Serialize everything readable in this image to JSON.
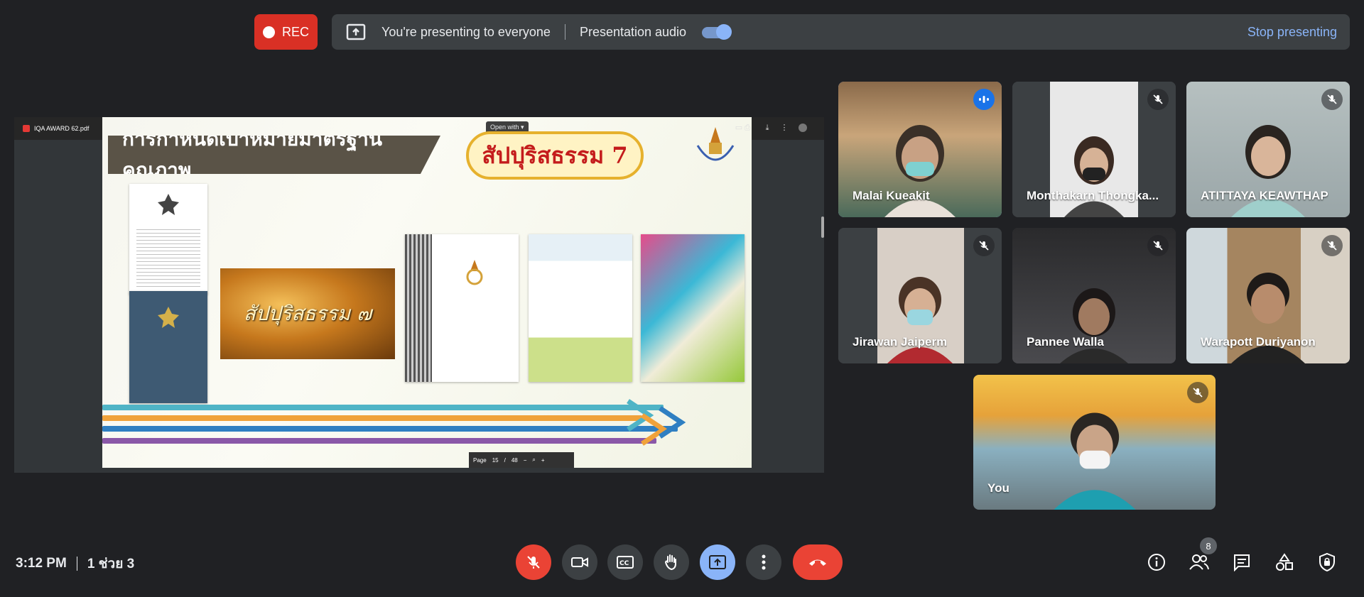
{
  "top_bar": {
    "rec_label": "REC",
    "presenting_text": "You're presenting to everyone",
    "audio_label": "Presentation audio",
    "audio_enabled": true,
    "stop_label": "Stop presenting"
  },
  "shared_screen": {
    "file_name": "IQA AWARD 62.pdf",
    "open_with_label": "Open with",
    "slide_title": "การกำหนดเป้าหมายมาตรฐานคุณภาพ",
    "slide_badge": "สัปปุริสธรรม 7",
    "poster_text": "สัปปุริสธรรม ๗",
    "page_label": "Page",
    "page_current": "15",
    "page_sep": "/",
    "page_total": "48"
  },
  "participants": [
    {
      "name": "Malai Kueakit",
      "speaking": true
    },
    {
      "name": "Monthakarn Thongka...",
      "muted": true
    },
    {
      "name": "ATITTAYA KEAWTHAP",
      "muted": true
    },
    {
      "name": "Jirawan Jaiperm",
      "muted": true
    },
    {
      "name": "Pannee Walla",
      "muted": true
    },
    {
      "name": "Warapott Duriyanon",
      "muted": true
    },
    {
      "name": "You",
      "muted": true
    }
  ],
  "bottom_bar": {
    "time": "3:12 PM",
    "meeting_name": "1 ช่วย 3",
    "people_count": "8",
    "icons": [
      "mic-off-icon",
      "camera-icon",
      "captions-icon",
      "raise-hand-icon",
      "present-icon",
      "more-icon",
      "leave-call-icon",
      "info-icon",
      "people-icon",
      "chat-icon",
      "activities-icon",
      "host-controls-icon"
    ]
  },
  "colors": {
    "background": "#202124",
    "surface": "#3c4043",
    "rec_red": "#d93025",
    "accent_blue": "#8ab4f8",
    "leave_red": "#ea4335"
  }
}
